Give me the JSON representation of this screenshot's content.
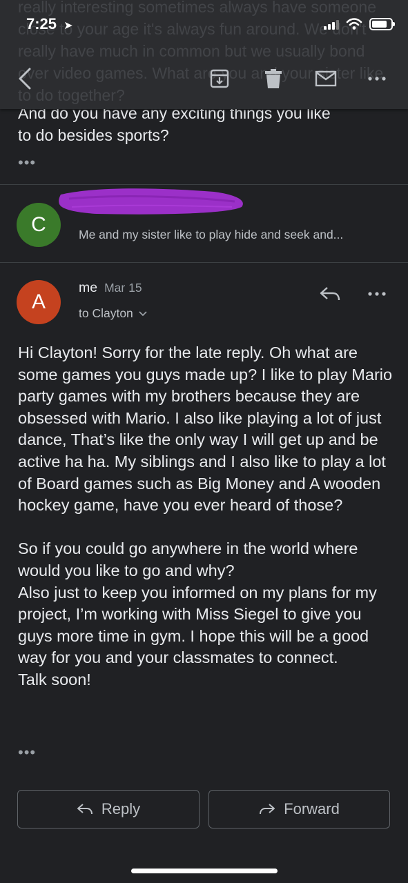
{
  "status_bar": {
    "time": "7:25"
  },
  "ghost_text": "really interesting sometimes always have someone close to your age it's always fun around. We don't really have much in common but we usually bond over video games. What are you and your sister like to do together?",
  "quoted": {
    "line1": "And do you have any exciting things you like",
    "line2": "to do besides sports?",
    "more": "•••"
  },
  "collapsed_message": {
    "avatar_letter": "C",
    "snippet": "Me and my sister like to play hide and seek and..."
  },
  "message": {
    "avatar_letter": "A",
    "sender": "me",
    "date": "Mar 15",
    "recipient": "to Clayton",
    "paragraphs": [
      "Hi Clayton! Sorry for the late reply. Oh what are some games you guys made up? I like to play Mario party games with my brothers because they are obsessed with Mario. I also like playing a lot of just dance, That’s like the only way I will get up and be active ha ha. My siblings and I also like to play a lot of Board games such as Big Money and A wooden hockey game, have you ever heard of those?",
      "So if you could go anywhere in the world where would you like to go and why?",
      "Also just to keep you informed on my plans for my project, I’m working with Miss Siegel to give you guys more time in gym. I hope this will be a good way for you and your classmates to connect.",
      "Talk soon!"
    ],
    "more": "•••"
  },
  "actions": {
    "reply": "Reply",
    "forward": "Forward"
  },
  "colors": {
    "avatar_c": "#3a7a2a",
    "avatar_a": "#c5421f",
    "redaction": "#9b30c8",
    "background": "#202124"
  }
}
